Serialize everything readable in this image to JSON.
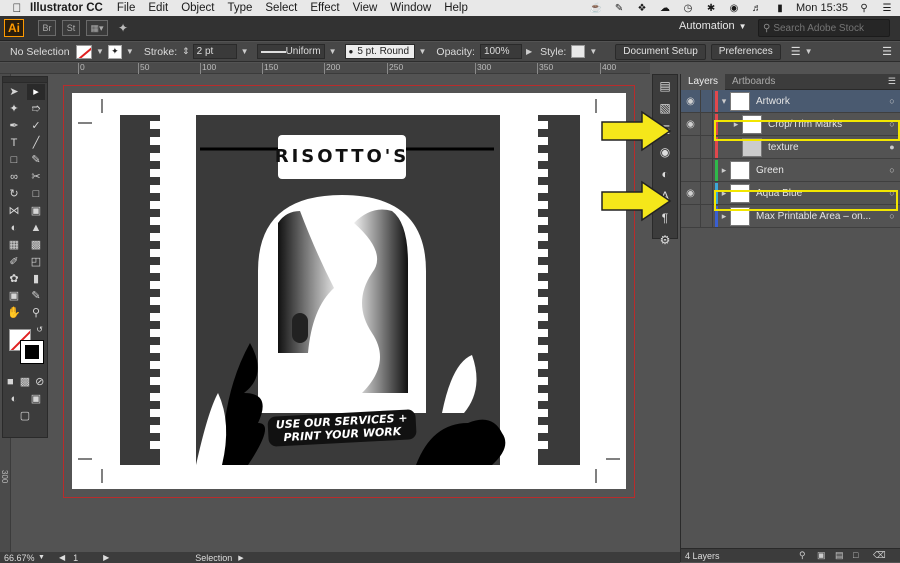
{
  "menubar": {
    "app_name": "Illustrator CC",
    "items": [
      "File",
      "Edit",
      "Object",
      "Type",
      "Select",
      "Effect",
      "View",
      "Window",
      "Help"
    ],
    "clock": "Mon 15:35"
  },
  "appbar": {
    "logo": "Ai",
    "bridge": "Br",
    "stock": "St",
    "workspace": "Automation",
    "search_placeholder": "Search Adobe Stock"
  },
  "controlbar": {
    "selection": "No Selection",
    "stroke_label": "Stroke:",
    "stroke_value": "2 pt",
    "profile": "Uniform",
    "brush": "5 pt. Round",
    "opacity_label": "Opacity:",
    "opacity_value": "100%",
    "style_label": "Style:",
    "doc_setup": "Document Setup",
    "preferences": "Preferences"
  },
  "ruler": {
    "top_labels": [
      "0",
      "50",
      "100",
      "150",
      "200",
      "250",
      "300",
      "350",
      "400"
    ],
    "left_label": "300"
  },
  "layers_panel": {
    "tabs": [
      "Layers",
      "Artboards"
    ],
    "layers": [
      {
        "name": "Artwork",
        "color": "#e0484d",
        "expanded": true,
        "selected": true,
        "visible": true
      },
      {
        "name": "Crop/Trim Marks",
        "color": "#e0484d",
        "expanded": false,
        "visible": true,
        "sublayer": true
      },
      {
        "name": "texture",
        "color": "#e0484d",
        "visible": false,
        "sublayer": true
      },
      {
        "name": "Green",
        "color": "#2fb84a",
        "expanded": false,
        "visible": false
      },
      {
        "name": "Aqua Blue",
        "color": "#3ca8d8",
        "expanded": false,
        "visible": true
      },
      {
        "name": "Max Printable Area – on...",
        "color": "#3a5fd0",
        "expanded": false,
        "visible": false
      }
    ],
    "footer": "4 Layers"
  },
  "artwork": {
    "title": "RISOTTO'S",
    "banner_line1": "USE OUR SERVICES +",
    "banner_line2": "PRINT YOUR WORK"
  },
  "statusbar": {
    "zoom": "66.67%",
    "artboard": "1",
    "mode": "Selection"
  }
}
